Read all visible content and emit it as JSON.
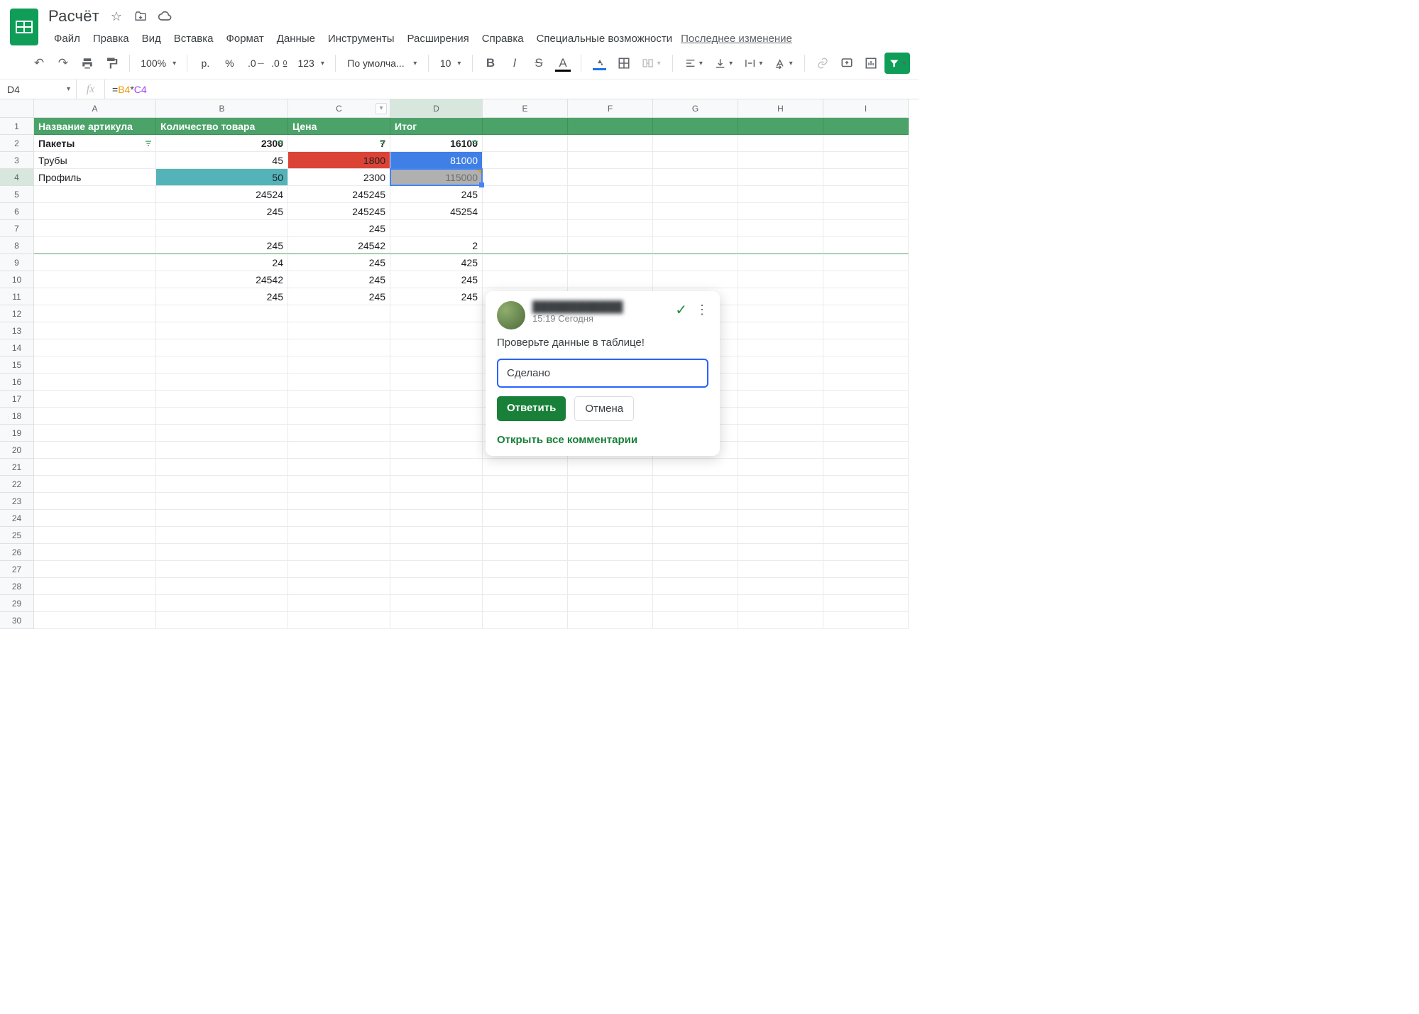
{
  "doc": {
    "title": "Расчёт"
  },
  "menu": {
    "file": "Файл",
    "edit": "Правка",
    "view": "Вид",
    "insert": "Вставка",
    "format": "Формат",
    "data": "Данные",
    "tools": "Инструменты",
    "extensions": "Расширения",
    "help": "Справка",
    "accessibility": "Специальные возможности",
    "last_change": "Последнее изменение"
  },
  "toolbar": {
    "zoom": "100%",
    "currency": "р.",
    "percent": "%",
    "dec_minus": ".0",
    "dec_plus": ".00",
    "num_format": "123",
    "font": "По умолча...",
    "font_size": "10"
  },
  "name_box": "D4",
  "formula": {
    "eq": "=",
    "ref1": "B4",
    "op": "*",
    "ref2": "C4"
  },
  "columns": [
    "A",
    "B",
    "C",
    "D",
    "E",
    "F",
    "G",
    "H",
    "I"
  ],
  "headers": {
    "A": "Название артикула",
    "B": "Количество товара",
    "C": "Цена",
    "D": "Итог"
  },
  "rows_visible": 30,
  "data": {
    "r2": {
      "A": "Пакеты",
      "B": "2300",
      "C": "7",
      "D": "16100"
    },
    "r3": {
      "A": "Трубы",
      "B": "45",
      "C": "1800",
      "D": "81000"
    },
    "r4": {
      "A": "Профиль",
      "B": "50",
      "C": "2300",
      "D": "115000"
    },
    "r5": {
      "B": "24524",
      "C": "245245",
      "D": "245"
    },
    "r6": {
      "B": "245",
      "C": "245245",
      "D": "45254"
    },
    "r7": {
      "C": "245"
    },
    "r8": {
      "B": "245",
      "C": "24542",
      "D": "2"
    },
    "r9": {
      "B": "24",
      "C": "245",
      "D": "425"
    },
    "r10": {
      "B": "24542",
      "C": "245",
      "D": "245"
    },
    "r11": {
      "B": "245",
      "C": "245",
      "D": "245"
    }
  },
  "comment": {
    "author": "████████████",
    "time": "15:19 Сегодня",
    "text": "Проверьте данные в таблице!",
    "reply_value": "Сделано",
    "reply_btn": "Ответить",
    "cancel_btn": "Отмена",
    "open_all": "Открыть все комментарии"
  }
}
